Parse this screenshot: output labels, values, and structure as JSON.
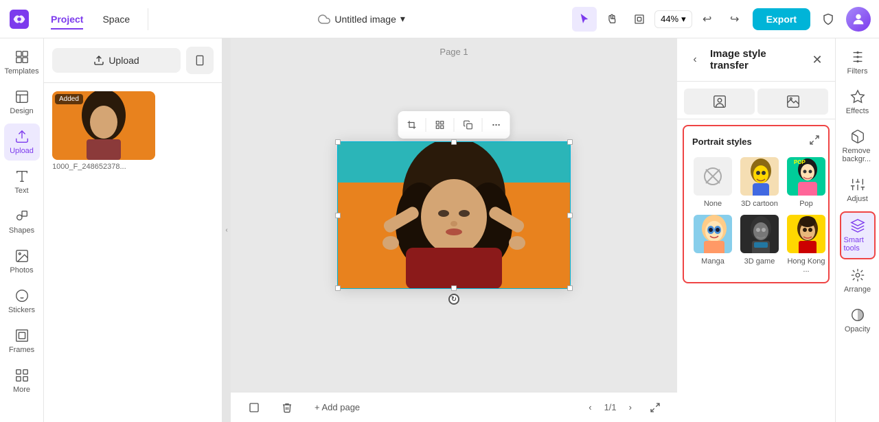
{
  "topbar": {
    "logo_label": "Canva",
    "nav_items": [
      {
        "label": "Project",
        "active": true
      },
      {
        "label": "Space",
        "active": false
      }
    ],
    "document_title": "Untitled image",
    "dropdown_icon": "▾",
    "zoom_level": "44%",
    "undo_icon": "↩",
    "redo_icon": "↪",
    "export_label": "Export",
    "shield_label": "Shield",
    "avatar_label": "User avatar"
  },
  "left_sidebar": {
    "items": [
      {
        "id": "templates",
        "label": "Templates",
        "icon": "grid"
      },
      {
        "id": "design",
        "label": "Design",
        "icon": "layout"
      },
      {
        "id": "upload",
        "label": "Upload",
        "icon": "upload",
        "active": true
      },
      {
        "id": "text",
        "label": "Text",
        "icon": "type"
      },
      {
        "id": "shapes",
        "label": "Shapes",
        "icon": "shapes"
      },
      {
        "id": "photos",
        "label": "Photos",
        "icon": "image"
      },
      {
        "id": "stickers",
        "label": "Stickers",
        "icon": "sticker"
      },
      {
        "id": "frames",
        "label": "Frames",
        "icon": "frame"
      },
      {
        "id": "more",
        "label": "More",
        "icon": "more"
      }
    ],
    "upload_button_label": "Upload",
    "mobile_icon": "📱",
    "uploaded_image_label": "1000_F_248652378...",
    "added_badge": "Added"
  },
  "canvas": {
    "page_label": "Page 1",
    "toolbar": {
      "crop_icon": "⊞",
      "grid_icon": "⊞",
      "copy_icon": "⊡",
      "more_icon": "···"
    }
  },
  "bottom_bar": {
    "page_icon": "⊡",
    "trash_icon": "🗑",
    "add_page_label": "+ Add page",
    "page_counter": "1/1",
    "fullscreen_icon": "⛶"
  },
  "style_transfer_panel": {
    "back_icon": "‹",
    "title": "Image style transfer",
    "close_icon": "✕",
    "tabs": [
      {
        "label": "portrait_tab",
        "icon": "👤",
        "active": false
      },
      {
        "label": "scene_tab",
        "icon": "🖼",
        "active": false
      }
    ],
    "portrait_section": {
      "title": "Portrait styles",
      "expand_icon": "⊞",
      "styles": [
        {
          "id": "none",
          "label": "None",
          "type": "none"
        },
        {
          "id": "3d_cartoon",
          "label": "3D cartoon",
          "type": "cartoon"
        },
        {
          "id": "pop",
          "label": "Pop",
          "type": "pop"
        },
        {
          "id": "manga",
          "label": "Manga",
          "type": "manga"
        },
        {
          "id": "3d_game",
          "label": "3D game",
          "type": "3dgame"
        },
        {
          "id": "hong_kong",
          "label": "Hong Kong ...",
          "type": "hk"
        }
      ]
    }
  },
  "right_sidebar": {
    "items": [
      {
        "id": "filters",
        "label": "Filters",
        "icon": "filter"
      },
      {
        "id": "effects",
        "label": "Effects",
        "icon": "effects"
      },
      {
        "id": "remove_bg",
        "label": "Remove backgr...",
        "icon": "removebg"
      },
      {
        "id": "adjust",
        "label": "Adjust",
        "icon": "adjust"
      },
      {
        "id": "smart_tools",
        "label": "Smart tools",
        "icon": "smart",
        "active": true
      },
      {
        "id": "arrange",
        "label": "Arrange",
        "icon": "arrange"
      },
      {
        "id": "opacity",
        "label": "Opacity",
        "icon": "opacity"
      }
    ]
  }
}
